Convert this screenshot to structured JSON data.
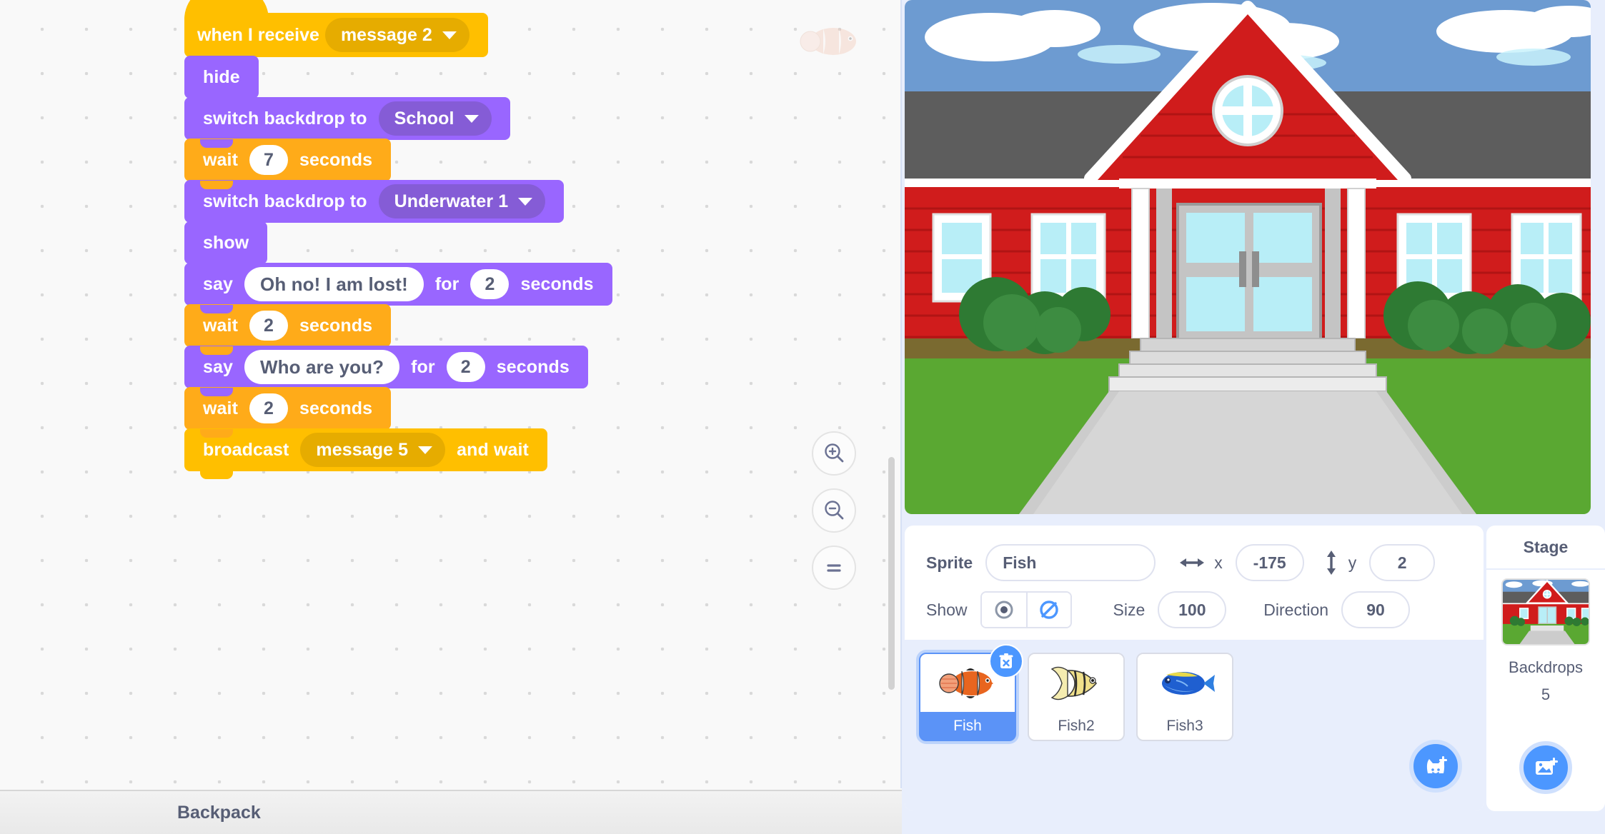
{
  "code_area": {
    "watermark_icon": "fish-sprite-watermark",
    "script": {
      "blocks": [
        {
          "id": "hat",
          "kind": "event-hat",
          "label": "when I receive",
          "dropdown": "message 2"
        },
        {
          "id": "b1",
          "kind": "looks",
          "label": "hide"
        },
        {
          "id": "b2",
          "kind": "looks",
          "label": "switch backdrop to",
          "dropdown": "School"
        },
        {
          "id": "b3",
          "kind": "control",
          "label": "wait",
          "value": "7",
          "label2": "seconds"
        },
        {
          "id": "b4",
          "kind": "looks",
          "label": "switch backdrop to",
          "dropdown": "Underwater 1"
        },
        {
          "id": "b5",
          "kind": "looks",
          "label": "show"
        },
        {
          "id": "b6",
          "kind": "looks",
          "label": "say",
          "text": "Oh no! I am lost!",
          "label2": "for",
          "value": "2",
          "label3": "seconds"
        },
        {
          "id": "b7",
          "kind": "control",
          "label": "wait",
          "value": "2",
          "label2": "seconds"
        },
        {
          "id": "b8",
          "kind": "looks",
          "label": "say",
          "text": "Who are you?",
          "label2": "for",
          "value": "2",
          "label3": "seconds"
        },
        {
          "id": "b9",
          "kind": "control",
          "label": "wait",
          "value": "2",
          "label2": "seconds"
        },
        {
          "id": "b10",
          "kind": "event",
          "label": "broadcast",
          "dropdown": "message 5",
          "label2": "and wait"
        }
      ]
    },
    "zoom_controls": [
      {
        "name": "zoom-in-icon",
        "label": "+"
      },
      {
        "name": "zoom-out-icon",
        "label": "-"
      },
      {
        "name": "zoom-reset-icon",
        "label": "="
      }
    ]
  },
  "backpack": {
    "label": "Backpack"
  },
  "stage": {
    "backdrop_name": "School",
    "alt": "School building backdrop"
  },
  "sprite_info": {
    "sprite_label": "Sprite",
    "sprite_name": "Fish",
    "x_label": "x",
    "x_value": "-175",
    "y_label": "y",
    "y_value": "2",
    "show_label": "Show",
    "show_visible_icon": "eye-show-icon",
    "show_hidden_icon": "eye-hidden-icon",
    "size_label": "Size",
    "size_value": "100",
    "direction_label": "Direction",
    "direction_value": "90"
  },
  "sprites": [
    {
      "name": "Fish",
      "selected": true,
      "icon": "clownfish-icon"
    },
    {
      "name": "Fish2",
      "selected": false,
      "icon": "yellow-fish-icon"
    },
    {
      "name": "Fish3",
      "selected": false,
      "icon": "blue-fish-icon"
    }
  ],
  "sprite_actions": {
    "delete_icon": "delete-trash-icon",
    "add_sprite_icon": "add-sprite-cat-icon"
  },
  "stage_panel": {
    "title": "Stage",
    "backdrops_label": "Backdrops",
    "backdrops_count": "5",
    "add_backdrop_icon": "add-backdrop-image-icon"
  },
  "colors": {
    "looks": "#9966ff",
    "looks_input": "#855cd6",
    "control": "#ffab19",
    "events": "#ffbf00",
    "events_input": "#e6ac00",
    "accent_blue": "#4c97ff",
    "text_grey": "#575e75",
    "panel_bg": "#e8eefc"
  }
}
